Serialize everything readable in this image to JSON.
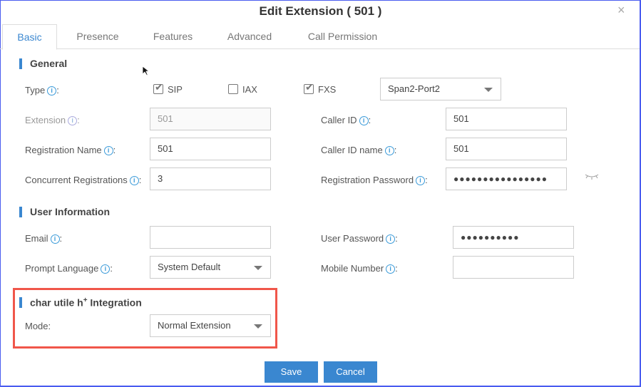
{
  "dialog": {
    "title": "Edit Extension ( 501 )",
    "close_icon": "×"
  },
  "tabs": [
    "Basic",
    "Presence",
    "Features",
    "Advanced",
    "Call Permission"
  ],
  "general": {
    "heading": "General",
    "type_label": "Type",
    "types": [
      {
        "label": "SIP",
        "checked": true
      },
      {
        "label": "IAX",
        "checked": false
      },
      {
        "label": "FXS",
        "checked": true
      }
    ],
    "port": "Span2-Port2",
    "extension_label": "Extension",
    "extension": "501",
    "caller_id_label": "Caller ID",
    "caller_id": "501",
    "reg_name_label": "Registration Name",
    "reg_name": "501",
    "caller_id_name_label": "Caller ID name",
    "caller_id_name": "501",
    "concurrent_label": "Concurrent Registrations",
    "concurrent": "3",
    "reg_password_label": "Registration Password",
    "reg_password": "●●●●●●●●●●●●●●●●"
  },
  "user": {
    "heading": "User Information",
    "email_label": "Email",
    "email": "",
    "user_password_label": "User Password",
    "user_password": "●●●●●●●●●●",
    "prompt_label": "Prompt Language",
    "prompt": "System Default",
    "mobile_label": "Mobile Number",
    "mobile": ""
  },
  "integration": {
    "heading": "char utile h",
    "heading_sup": "+",
    "heading_tail": " Integration",
    "mode_label": "Mode:",
    "mode": "Normal Extension"
  },
  "footer": {
    "save": "Save",
    "cancel": "Cancel"
  },
  "colors": {
    "accent": "#3a87d0",
    "highlight": "#f0564a"
  }
}
